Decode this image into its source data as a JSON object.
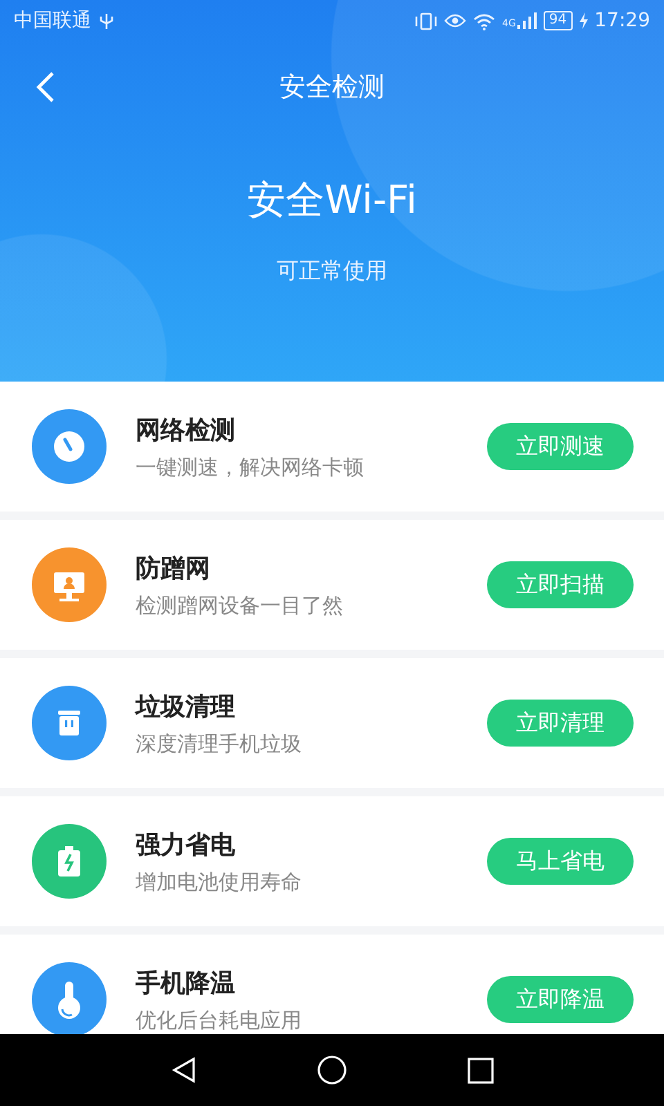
{
  "status_bar": {
    "carrier": "中国联通",
    "network": "4G",
    "battery": "94",
    "time": "17:29"
  },
  "header": {
    "title": "安全检测",
    "network_name": "安全Wi-Fi",
    "status": "可正常使用"
  },
  "items": [
    {
      "kind": "speed",
      "color": "#3399f3",
      "title": "网络检测",
      "subtitle": "一键测速，解决网络卡顿",
      "action": "立即测速"
    },
    {
      "kind": "monitor",
      "color": "#f7932e",
      "title": "防蹭网",
      "subtitle": "检测蹭网设备一目了然",
      "action": "立即扫描"
    },
    {
      "kind": "trash",
      "color": "#3399f3",
      "title": "垃圾清理",
      "subtitle": "深度清理手机垃圾",
      "action": "立即清理"
    },
    {
      "kind": "battery",
      "color": "#27c47d",
      "title": "强力省电",
      "subtitle": "增加电池使用寿命",
      "action": "马上省电"
    },
    {
      "kind": "thermo",
      "color": "#3399f3",
      "title": "手机降温",
      "subtitle": "优化后台耗电应用",
      "action": "立即降温"
    }
  ]
}
